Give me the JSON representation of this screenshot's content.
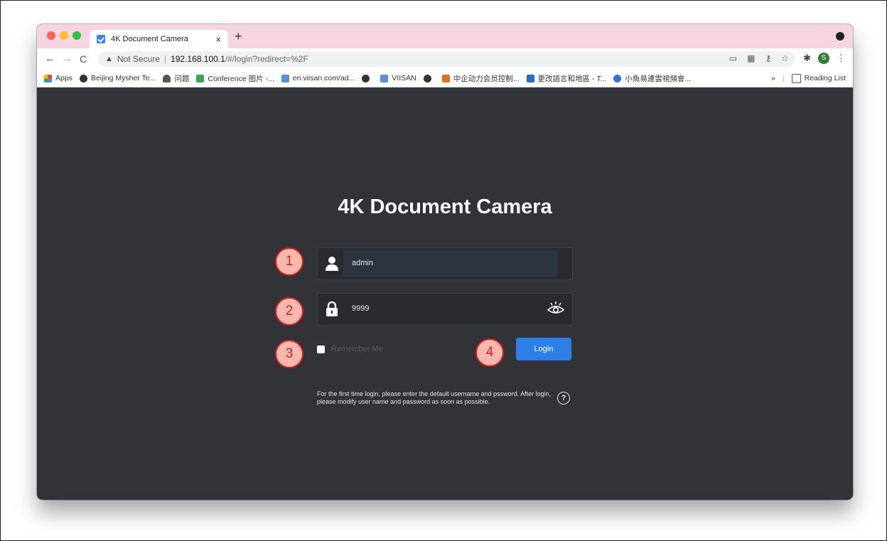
{
  "browser": {
    "tab_title": "4K Document Camera",
    "tab_close": "×",
    "new_tab": "+",
    "address": {
      "security_label": "Not Secure",
      "host": "192.168.100.1",
      "path": "/#/login?redirect=%2F"
    },
    "bookmarks": [
      {
        "label": "Apps"
      },
      {
        "label": "Beijing Mysher Te..."
      },
      {
        "label": "问题"
      },
      {
        "label": "Conference 图片 -..."
      },
      {
        "label": "en.viisan.com/ad..."
      },
      {
        "label": ""
      },
      {
        "label": "VIISAN"
      },
      {
        "label": ""
      },
      {
        "label": "中企动力会员控制..."
      },
      {
        "label": "更改語言和地區 - T..."
      },
      {
        "label": "小魚易連雲視頻會..."
      }
    ],
    "bookmarks_overflow": "»",
    "reading_list": "Reading List",
    "avatar_initial": "S"
  },
  "login": {
    "title": "4K Document Camera",
    "username_value": "admin",
    "password_value": "9999",
    "remember_label": "Remember Me",
    "login_button": "Login",
    "hint": "For the first time login, please enter the default username and pssword. After login, please modify user name and password as soon as possible.",
    "help_symbol": "?"
  },
  "callouts": [
    "1",
    "2",
    "3",
    "4"
  ],
  "colors": {
    "tabstrip": "#f6d5e3",
    "page_bg": "#323337",
    "login_button": "#2d7ee6",
    "callout_border": "#d51f1f",
    "callout_fill": "#f8b8ad"
  }
}
